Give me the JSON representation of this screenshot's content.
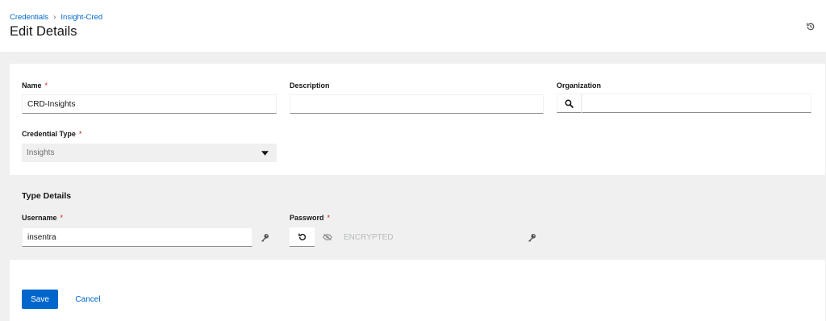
{
  "breadcrumb": {
    "root": "Credentials",
    "current": "Insight-Cred"
  },
  "page": {
    "title": "Edit Details"
  },
  "form": {
    "name": {
      "label": "Name",
      "required_mark": "*",
      "value": "CRD-Insights"
    },
    "description": {
      "label": "Description",
      "value": ""
    },
    "organization": {
      "label": "Organization",
      "value": ""
    },
    "credential_type": {
      "label": "Credential Type",
      "required_mark": "*",
      "selected": "Insights"
    }
  },
  "type_details": {
    "title": "Type Details",
    "username": {
      "label": "Username",
      "required_mark": "*",
      "value": "insentra"
    },
    "password": {
      "label": "Password",
      "required_mark": "*",
      "placeholder": "ENCRYPTED"
    }
  },
  "actions": {
    "save": "Save",
    "cancel": "Cancel"
  },
  "icons": {
    "history": "history-icon",
    "search": "search-icon",
    "dropdown": "caret-down-icon",
    "key": "key-icon",
    "revert": "undo-icon",
    "hidden": "eye-slash-icon"
  },
  "colors": {
    "primary": "#0066cc",
    "required": "#c9190b",
    "background": "#f0f0f0"
  }
}
